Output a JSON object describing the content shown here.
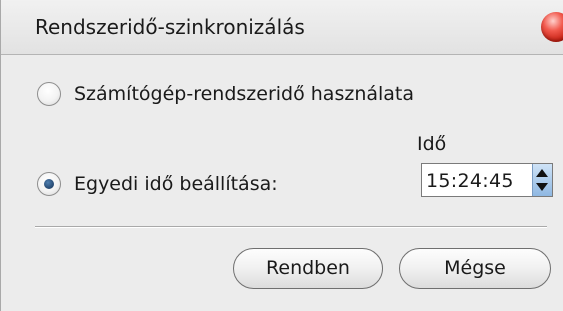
{
  "window": {
    "title": "Rendszeridő-szinkronizálás"
  },
  "options": {
    "use_system_time": {
      "label": "Számítógép-rendszeridő használata",
      "selected": false
    },
    "custom_time": {
      "label": "Egyedi idő beállítása:",
      "selected": true
    }
  },
  "time": {
    "label": "Idő",
    "value": "15:24:45"
  },
  "buttons": {
    "ok_label": "Rendben",
    "cancel_label": "Mégse"
  },
  "colors": {
    "close_button": "#e0483b",
    "spinner_accent": "#8fb8e2",
    "dialog_background": "#ececec"
  },
  "icons": {
    "close": "close-icon",
    "spin_up": "spin-up-arrow-icon",
    "spin_down": "spin-down-arrow-icon"
  }
}
